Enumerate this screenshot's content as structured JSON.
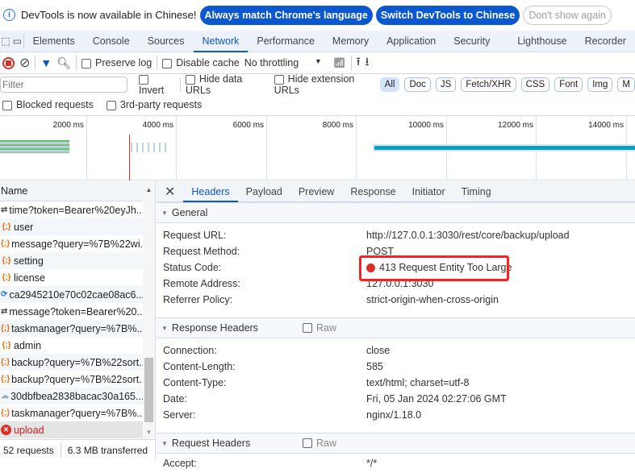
{
  "infobar": {
    "message": "DevTools is now available in Chinese!",
    "btn_match": "Always match Chrome's language",
    "btn_switch": "Switch DevTools to Chinese",
    "btn_dismiss": "Don't show again"
  },
  "tabs": [
    "Elements",
    "Console",
    "Sources",
    "Network",
    "Performance",
    "Memory",
    "Application",
    "Security",
    "Lighthouse",
    "Recorder"
  ],
  "active_tab": "Network",
  "toolbar": {
    "preserve_log": "Preserve log",
    "disable_cache": "Disable cache",
    "throttling": "No throttling"
  },
  "filter": {
    "placeholder": "Filter",
    "invert": "Invert",
    "hide_data": "Hide data URLs",
    "hide_ext": "Hide extension URLs",
    "types": [
      "All",
      "Doc",
      "JS",
      "Fetch/XHR",
      "CSS",
      "Font",
      "Img",
      "M"
    ]
  },
  "row3": {
    "blocked": "Blocked requests",
    "third": "3rd-party requests"
  },
  "timeline": {
    "ticks": [
      "2000 ms",
      "4000 ms",
      "6000 ms",
      "8000 ms",
      "10000 ms",
      "12000 ms",
      "14000 ms"
    ]
  },
  "requests": {
    "header": "Name",
    "items": [
      {
        "name": "time?token=Bearer%20eyJh...",
        "icon": "websocket-icon"
      },
      {
        "name": "user",
        "icon": "fetch-icon"
      },
      {
        "name": "message?query=%7B%22wi...",
        "icon": "fetch-icon"
      },
      {
        "name": "setting",
        "icon": "fetch-icon"
      },
      {
        "name": "license",
        "icon": "fetch-icon"
      },
      {
        "name": "ca2945210e70c02cae08ac6...",
        "icon": "script-icon"
      },
      {
        "name": "message?token=Bearer%20...",
        "icon": "websocket-icon"
      },
      {
        "name": "taskmanager?query=%7B%...",
        "icon": "fetch-icon"
      },
      {
        "name": "admin",
        "icon": "fetch-icon"
      },
      {
        "name": "backup?query=%7B%22sort...",
        "icon": "fetch-icon"
      },
      {
        "name": "backup?query=%7B%22sort...",
        "icon": "fetch-icon"
      },
      {
        "name": "30dbfbea2838bacac30a165...",
        "icon": "image-icon"
      },
      {
        "name": "taskmanager?query=%7B%...",
        "icon": "fetch-icon"
      },
      {
        "name": "upload",
        "icon": "error-icon"
      }
    ],
    "count": "52 requests",
    "transferred": "6.3 MB transferred"
  },
  "details": {
    "tabs": [
      "Headers",
      "Payload",
      "Preview",
      "Response",
      "Initiator",
      "Timing"
    ],
    "active": "Headers",
    "general": {
      "title": "General",
      "rows": [
        {
          "k": "Request URL:",
          "v": "http://127.0.0.1:3030/rest/core/backup/upload"
        },
        {
          "k": "Request Method:",
          "v": "POST"
        },
        {
          "k": "Status Code:",
          "v": "413 Request Entity Too Large"
        },
        {
          "k": "Remote Address:",
          "v": "127.0.0.1:3030"
        },
        {
          "k": "Referrer Policy:",
          "v": "strict-origin-when-cross-origin"
        }
      ]
    },
    "response": {
      "title": "Response Headers",
      "raw": "Raw",
      "rows": [
        {
          "k": "Connection:",
          "v": "close"
        },
        {
          "k": "Content-Length:",
          "v": "585"
        },
        {
          "k": "Content-Type:",
          "v": "text/html; charset=utf-8"
        },
        {
          "k": "Date:",
          "v": "Fri, 05 Jan 2024 02:27:06 GMT"
        },
        {
          "k": "Server:",
          "v": "nginx/1.18.0"
        }
      ]
    },
    "request": {
      "title": "Request Headers",
      "raw": "Raw",
      "rows": [
        {
          "k": "Accept:",
          "v": "*/*"
        }
      ]
    }
  },
  "colors": {
    "accent": "#0b57d0",
    "error": "#d93025",
    "highlight": "#ff1f1f"
  }
}
